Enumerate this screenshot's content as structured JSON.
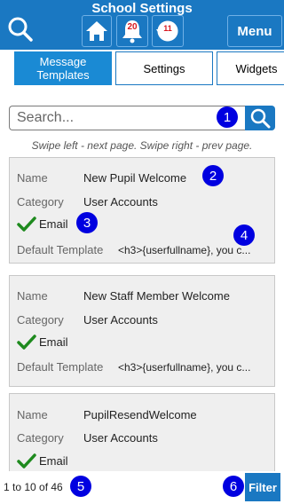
{
  "app": {
    "title": "School Settings"
  },
  "header": {
    "search_icon": "search-icon",
    "home_icon": "home-icon",
    "bell_icon": "bell-icon",
    "bell_count": "20",
    "clock_icon": "history-icon",
    "clock_count": "11",
    "menu_label": "Menu"
  },
  "tabs": [
    {
      "label": "Message Templates",
      "active": true
    },
    {
      "label": "Settings",
      "active": false
    },
    {
      "label": "Widgets",
      "active": false
    }
  ],
  "search": {
    "placeholder": "Search...",
    "value": ""
  },
  "hint": "Swipe left - next page. Swipe right - prev page.",
  "labels": {
    "name": "Name",
    "category": "Category",
    "email": "Email",
    "default_template": "Default Template"
  },
  "templates": [
    {
      "name": "New Pupil Welcome",
      "category": "User Accounts",
      "default_template": "<h3>{userfullname}, you c..."
    },
    {
      "name": "New Staff Member Welcome",
      "category": "User Accounts",
      "default_template": "<h3>{userfullname}, you c..."
    },
    {
      "name": "PupilResendWelcome",
      "category": "User Accounts",
      "default_template": ""
    }
  ],
  "markers": [
    "1",
    "2",
    "3",
    "4",
    "5",
    "6"
  ],
  "footer": {
    "pager": "1 to 10 of 46",
    "filter_label": "Filter"
  },
  "colors": {
    "primary": "#1a78c2",
    "tab_active": "#1a8ad4",
    "marker": "#0000e0",
    "check": "#1e8a1e",
    "badge": "#d81920"
  }
}
